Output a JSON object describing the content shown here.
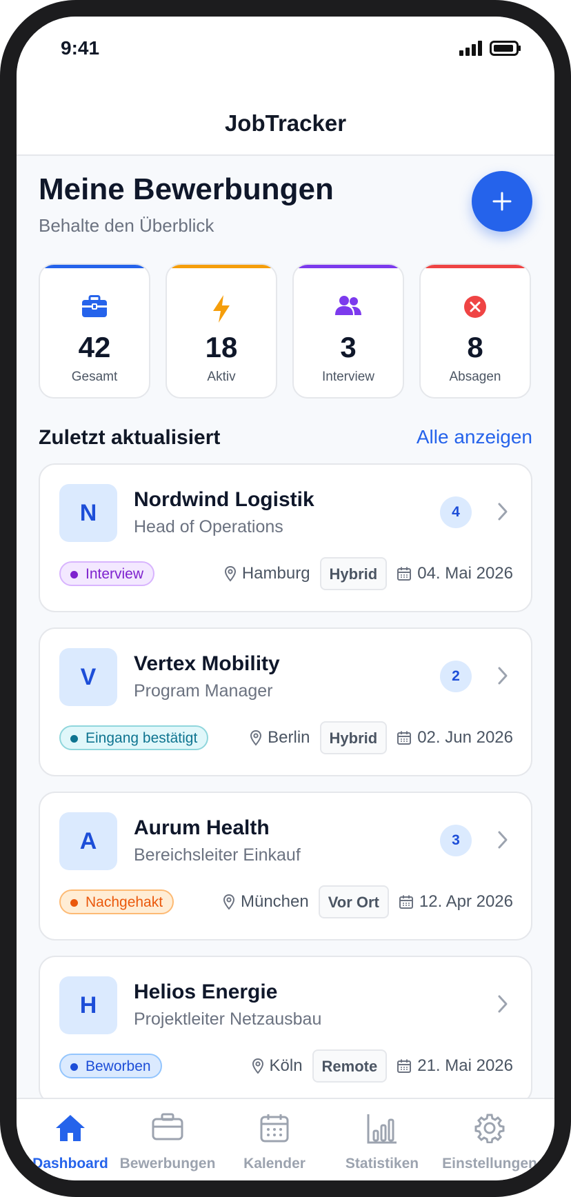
{
  "status_bar": {
    "time": "9:41"
  },
  "app": {
    "title": "JobTracker"
  },
  "header": {
    "title": "Meine Bewerbungen",
    "subtitle": "Behalte den Überblick"
  },
  "stats": [
    {
      "value": "42",
      "label": "Gesamt",
      "color": "#2563eb",
      "icon": "briefcase-icon"
    },
    {
      "value": "18",
      "label": "Aktiv",
      "color": "#f59e0b",
      "icon": "lightning-icon"
    },
    {
      "value": "3",
      "label": "Interview",
      "color": "#7c3aed",
      "icon": "users-icon"
    },
    {
      "value": "8",
      "label": "Absagen",
      "color": "#ef4444",
      "icon": "x-circle-icon"
    }
  ],
  "recent": {
    "title": "Zuletzt aktualisiert",
    "link": "Alle anzeigen",
    "items": [
      {
        "initial": "N",
        "company": "Nordwind Logistik",
        "role": "Head of Operations",
        "count": "4",
        "status": "Interview",
        "location": "Hamburg",
        "mode": "Hybrid",
        "date": "04. Mai 2026"
      },
      {
        "initial": "V",
        "company": "Vertex Mobility",
        "role": "Program Manager",
        "count": "2",
        "status": "Eingang bestätigt",
        "location": "Berlin",
        "mode": "Hybrid",
        "date": "02. Jun 2026"
      },
      {
        "initial": "A",
        "company": "Aurum Health",
        "role": "Bereichsleiter Einkauf",
        "count": "3",
        "status": "Nachgehakt",
        "location": "München",
        "mode": "Vor Ort",
        "date": "12. Apr 2026"
      },
      {
        "initial": "H",
        "company": "Helios Energie",
        "role": "Projektleiter Netzausbau",
        "status": "Beworben",
        "location": "Köln",
        "mode": "Remote",
        "date": "21. Mai 2026"
      }
    ]
  },
  "tabs": [
    {
      "label": "Dashboard",
      "icon": "home-icon",
      "active": true
    },
    {
      "label": "Bewerbungen",
      "icon": "briefcase-icon"
    },
    {
      "label": "Kalender",
      "icon": "calendar-icon"
    },
    {
      "label": "Statistiken",
      "icon": "chart-icon"
    },
    {
      "label": "Einstellungen",
      "icon": "gear-icon"
    }
  ],
  "colors": {
    "primary": "#2563eb",
    "text": "#0f172a",
    "muted": "#6b7280"
  }
}
